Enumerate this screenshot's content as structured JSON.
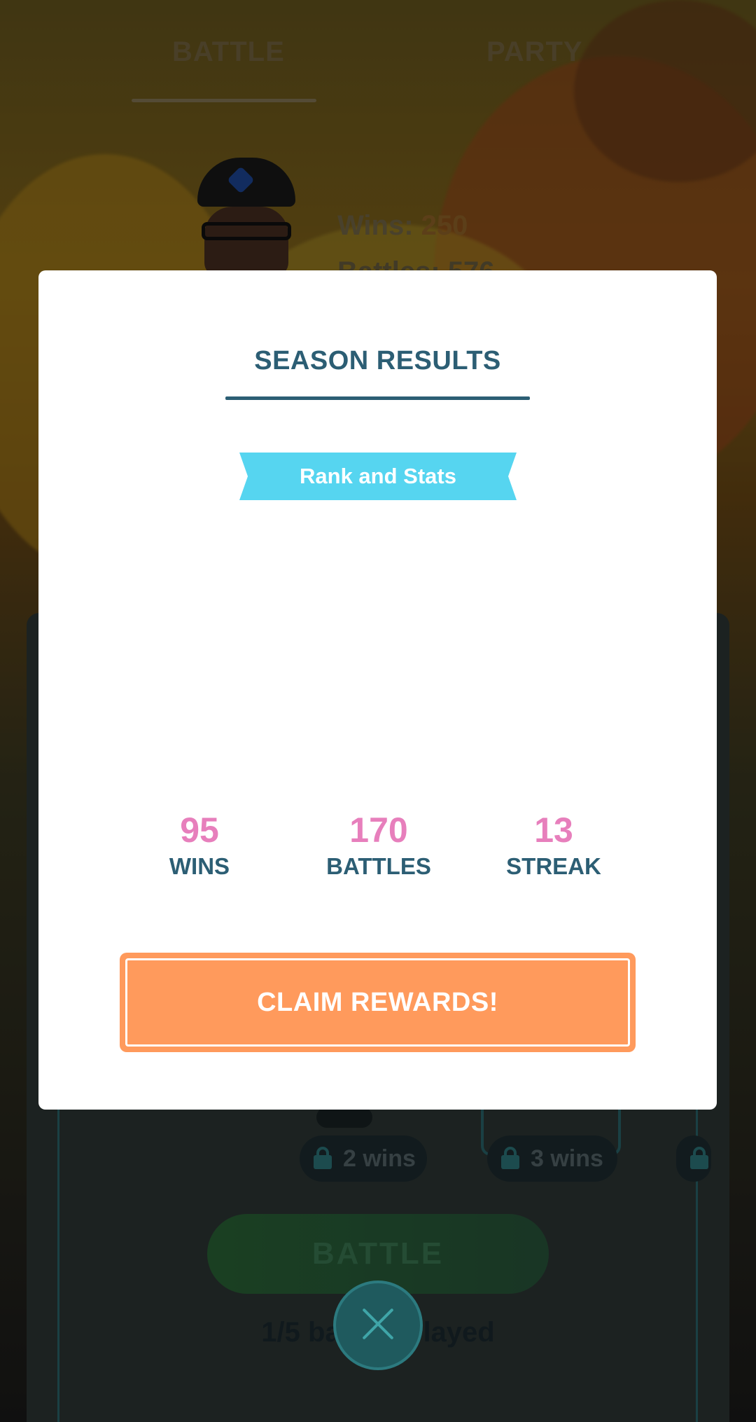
{
  "background": {
    "tabs": {
      "battle": "BATTLE",
      "party": "PARTY"
    },
    "stats": {
      "wins_label": "Wins:",
      "wins_value": "250",
      "battles_partial": "Battles: 576"
    },
    "rewards": [
      {
        "label": "2 wins",
        "locked": true
      },
      {
        "label": "3 wins",
        "locked": true
      }
    ],
    "battle_button": "BATTLE",
    "played_text": "1/5 battles played"
  },
  "modal": {
    "title": "SEASON RESULTS",
    "ribbon": "Rank and Stats",
    "stats": {
      "wins": {
        "value": "95",
        "label": "WINS"
      },
      "battles": {
        "value": "170",
        "label": "BATTLES"
      },
      "streak": {
        "value": "13",
        "label": "STREAK"
      }
    },
    "claim_button": "CLAIM REWARDS!"
  },
  "colors": {
    "title": "#2c5e74",
    "ribbon": "#56d5f0",
    "stat_value": "#e77fbc",
    "claim_button": "#ff9a5c"
  },
  "icons": {
    "close": "close-icon",
    "lock": "lock-icon",
    "avatar": "trainer-avatar"
  }
}
